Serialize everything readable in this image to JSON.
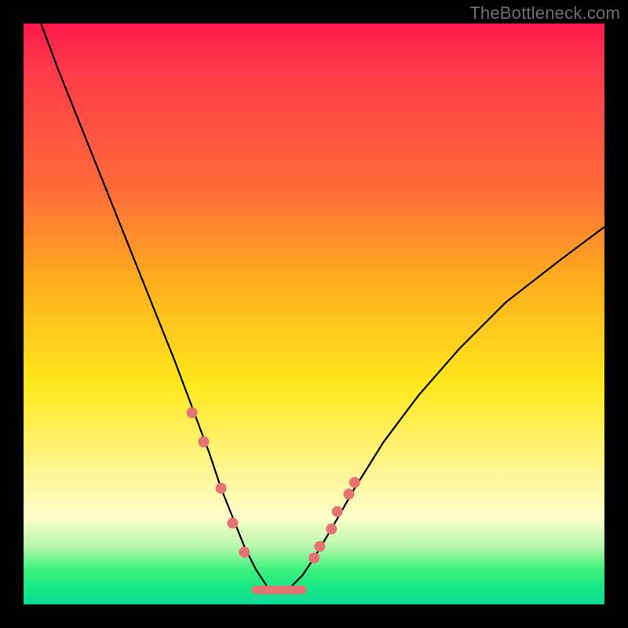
{
  "watermark": "TheBottleneck.com",
  "chart_data": {
    "type": "line",
    "title": "",
    "xlabel": "",
    "ylabel": "",
    "xlim": [
      0,
      100
    ],
    "ylim": [
      0,
      100
    ],
    "grid": false,
    "legend": false,
    "description": "Bottleneck-style V-curve on a vertical rainbow gradient. Black curve descends steeply from upper-left, bottoms out near x≈44 at y≈2, and rises to upper-right area. Salmon dots cluster along the lower portion of both arms, with a short flat salmon segment at the valley. Y increases upward; gradient is cosmetic (red high, green low).",
    "series": [
      {
        "name": "curve",
        "color": "#000000",
        "x": [
          3,
          6,
          10,
          14,
          18,
          22,
          26,
          29,
          32,
          34,
          36,
          38,
          40,
          42,
          44,
          46,
          48,
          50,
          53,
          57,
          62,
          68,
          75,
          83,
          92,
          100
        ],
        "y": [
          100,
          92,
          82,
          72,
          62,
          52,
          42,
          34,
          26,
          20,
          15,
          10,
          6,
          3,
          2,
          3,
          5,
          8,
          13,
          20,
          28,
          36,
          44,
          52,
          59,
          65
        ]
      }
    ],
    "markers": {
      "name": "dots",
      "color": "#e57373",
      "x": [
        29,
        31,
        34,
        36,
        38,
        50,
        51,
        53,
        54,
        56,
        57
      ],
      "y": [
        33,
        28,
        20,
        14,
        9,
        8,
        10,
        13,
        16,
        19,
        21
      ]
    },
    "valley_segment": {
      "name": "valley-flat",
      "color": "#e57373",
      "x": [
        40,
        48
      ],
      "y": [
        2.5,
        2.5
      ]
    }
  }
}
